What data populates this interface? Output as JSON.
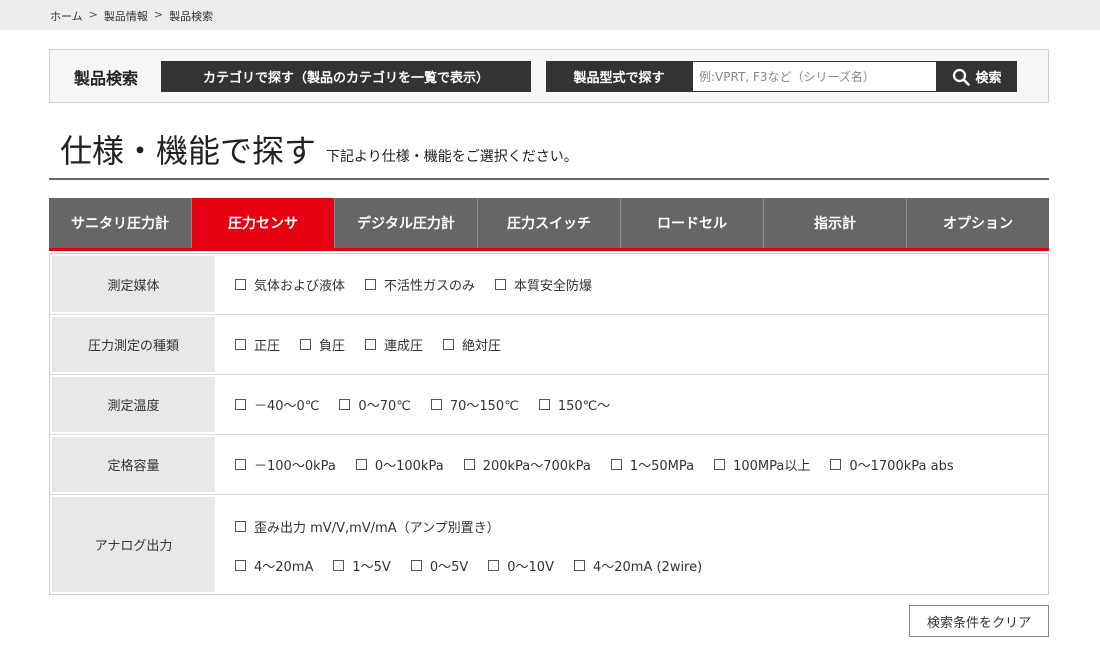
{
  "breadcrumb": {
    "home": "ホーム",
    "sep": ">",
    "level1": "製品情報",
    "level2": "製品検索"
  },
  "search": {
    "label": "製品検索",
    "category_button": "カテゴリで探す（製品のカテゴリを一覧で表示）",
    "model_button": "製品型式で探す",
    "model_placeholder": "例:VPRT, F3など（シリーズ名）",
    "search_button": "検索"
  },
  "heading": {
    "title": "仕様・機能で探す",
    "subtitle": "下記より仕様・機能をご選択ください。"
  },
  "tabs": [
    {
      "label": "サニタリ圧力計"
    },
    {
      "label": "圧力センサ"
    },
    {
      "label": "デジタル圧力計"
    },
    {
      "label": "圧力スイッチ"
    },
    {
      "label": "ロードセル"
    },
    {
      "label": "指示計"
    },
    {
      "label": "オプション"
    }
  ],
  "active_tab": "圧力センサ",
  "filters": [
    {
      "name": "測定媒体",
      "options": [
        "気体および液体",
        "不活性ガスのみ",
        "本質安全防爆"
      ]
    },
    {
      "name": "圧力測定の種類",
      "options": [
        "正圧",
        "負圧",
        "連成圧",
        "絶対圧"
      ]
    },
    {
      "name": "測定温度",
      "options": [
        "－40～0℃",
        "0～70℃",
        "70～150℃",
        "150℃～"
      ]
    },
    {
      "name": "定格容量",
      "options": [
        "－100～0kPa",
        "0～100kPa",
        "200kPa～700kPa",
        "1～50MPa",
        "100MPa以上",
        "0～1700kPa abs"
      ]
    },
    {
      "name": "アナログ出力",
      "options": [
        "歪み出力 mV/V,mV/mA（アンプ別置き）",
        "4～20mA",
        "1～5V",
        "0～5V",
        "0～10V",
        "4～20mA (2wire)"
      ]
    }
  ],
  "clear_button": "検索条件をクリア",
  "colors": {
    "accent": "#e60012",
    "dark": "#333333",
    "tab_bg": "#666666",
    "header_cell": "#e8e8e8"
  }
}
